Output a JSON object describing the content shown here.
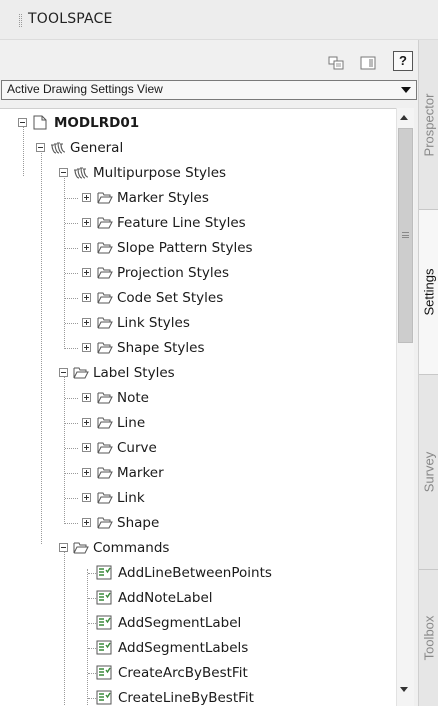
{
  "titlebar": {
    "title": "TOOLSPACE"
  },
  "toolbar": {
    "help_label": "?"
  },
  "view_select": {
    "value": "Active Drawing Settings View"
  },
  "tabs": [
    {
      "label": "Prospector",
      "active": false
    },
    {
      "label": "Settings",
      "active": true
    },
    {
      "label": "Survey",
      "active": false
    },
    {
      "label": "Toolbox",
      "active": false
    }
  ],
  "tree": {
    "root": {
      "label": "MODLRD01",
      "icon": "drawing-icon"
    },
    "general": {
      "label": "General",
      "icon": "settings-icon"
    },
    "multipurpose": {
      "label": "Multipurpose Styles",
      "icon": "settings-icon"
    },
    "multipurpose_items": [
      {
        "label": "Marker Styles"
      },
      {
        "label": "Feature Line Styles"
      },
      {
        "label": "Slope Pattern Styles"
      },
      {
        "label": "Projection Styles"
      },
      {
        "label": "Code Set Styles"
      },
      {
        "label": "Link Styles"
      },
      {
        "label": "Shape Styles"
      }
    ],
    "label_styles": {
      "label": "Label Styles",
      "icon": "folder-icon"
    },
    "label_items": [
      {
        "label": "Note"
      },
      {
        "label": "Line"
      },
      {
        "label": "Curve"
      },
      {
        "label": "Marker"
      },
      {
        "label": "Link"
      },
      {
        "label": "Shape"
      }
    ],
    "commands": {
      "label": "Commands",
      "icon": "folder-icon"
    },
    "command_items": [
      {
        "label": "AddLineBetweenPoints"
      },
      {
        "label": "AddNoteLabel"
      },
      {
        "label": "AddSegmentLabel"
      },
      {
        "label": "AddSegmentLabels"
      },
      {
        "label": "CreateArcByBestFit"
      },
      {
        "label": "CreateLineByBestFit"
      }
    ]
  },
  "colors": {
    "background": "#f0f0f0",
    "panel": "#ffffff",
    "command_icon": "#3a8a3a"
  }
}
